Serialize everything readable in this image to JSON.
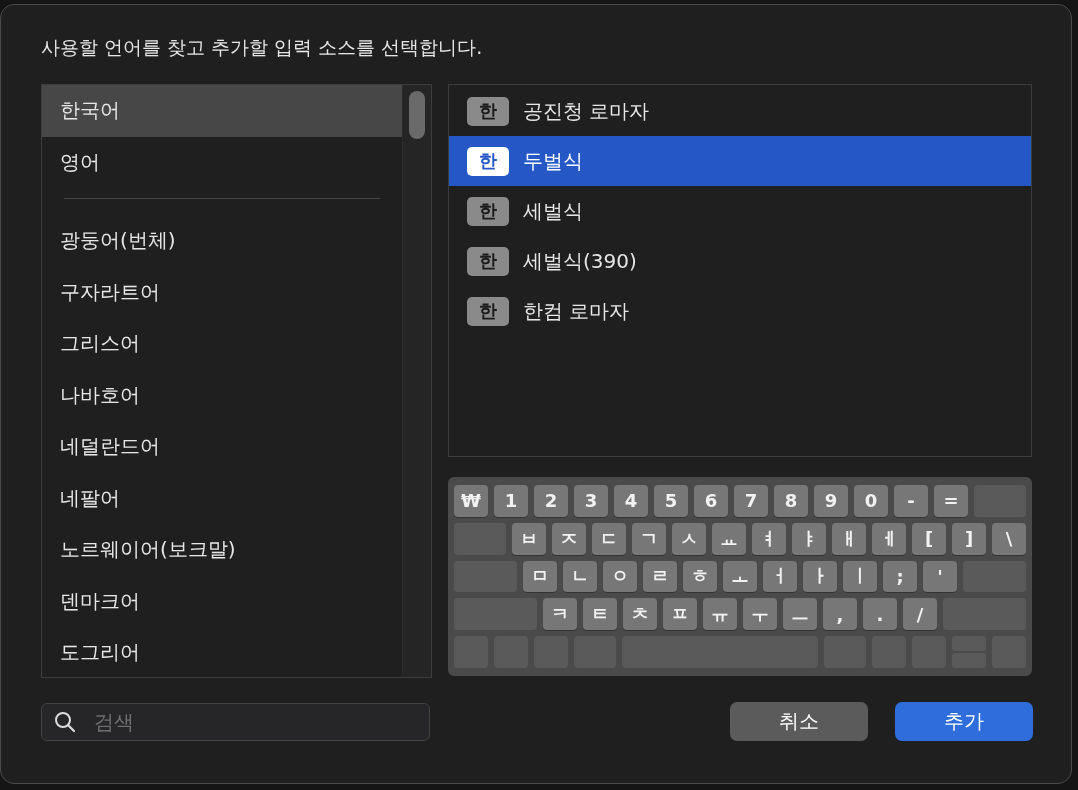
{
  "dialog": {
    "prompt": "사용할 언어를 찾고 추가할 입력 소스를 선택합니다."
  },
  "language_list": {
    "suggested": [
      {
        "label": "한국어",
        "selected": true
      },
      {
        "label": "영어",
        "selected": false
      }
    ],
    "others": [
      {
        "label": "광둥어(번체)",
        "selected": false
      },
      {
        "label": "구자라트어",
        "selected": false
      },
      {
        "label": "그리스어",
        "selected": false
      },
      {
        "label": "나바호어",
        "selected": false
      },
      {
        "label": "네덜란드어",
        "selected": false
      },
      {
        "label": "네팔어",
        "selected": false
      },
      {
        "label": "노르웨이어(보크말)",
        "selected": false
      },
      {
        "label": "덴마크어",
        "selected": false
      },
      {
        "label": "도그리어",
        "selected": false
      }
    ]
  },
  "input_sources": [
    {
      "badge": "한",
      "label": "공진청 로마자",
      "selected": false
    },
    {
      "badge": "한",
      "label": "두벌식",
      "selected": true
    },
    {
      "badge": "한",
      "label": "세벌식",
      "selected": false
    },
    {
      "badge": "한",
      "label": "세벌식(390)",
      "selected": false
    },
    {
      "badge": "한",
      "label": "한컴 로마자",
      "selected": false
    }
  ],
  "keyboard": {
    "rows": [
      [
        {
          "kind": "key",
          "label": "₩"
        },
        {
          "kind": "key",
          "label": "1"
        },
        {
          "kind": "key",
          "label": "2"
        },
        {
          "kind": "key",
          "label": "3"
        },
        {
          "kind": "key",
          "label": "4"
        },
        {
          "kind": "key",
          "label": "5"
        },
        {
          "kind": "key",
          "label": "6"
        },
        {
          "kind": "key",
          "label": "7"
        },
        {
          "kind": "key",
          "label": "8"
        },
        {
          "kind": "key",
          "label": "9"
        },
        {
          "kind": "key",
          "label": "0"
        },
        {
          "kind": "key",
          "label": "-"
        },
        {
          "kind": "key",
          "label": "="
        },
        {
          "kind": "fill"
        }
      ],
      [
        {
          "kind": "fill"
        },
        {
          "kind": "key",
          "label": "ㅂ"
        },
        {
          "kind": "key",
          "label": "ㅈ"
        },
        {
          "kind": "key",
          "label": "ㄷ"
        },
        {
          "kind": "key",
          "label": "ㄱ"
        },
        {
          "kind": "key",
          "label": "ㅅ"
        },
        {
          "kind": "key",
          "label": "ㅛ"
        },
        {
          "kind": "key",
          "label": "ㅕ"
        },
        {
          "kind": "key",
          "label": "ㅑ"
        },
        {
          "kind": "key",
          "label": "ㅐ"
        },
        {
          "kind": "key",
          "label": "ㅔ"
        },
        {
          "kind": "key",
          "label": "["
        },
        {
          "kind": "key",
          "label": "]"
        },
        {
          "kind": "key",
          "label": "\\"
        }
      ],
      [
        {
          "kind": "fill"
        },
        {
          "kind": "key",
          "label": "ㅁ"
        },
        {
          "kind": "key",
          "label": "ㄴ"
        },
        {
          "kind": "key",
          "label": "ㅇ"
        },
        {
          "kind": "key",
          "label": "ㄹ"
        },
        {
          "kind": "key",
          "label": "ㅎ"
        },
        {
          "kind": "key",
          "label": "ㅗ"
        },
        {
          "kind": "key",
          "label": "ㅓ"
        },
        {
          "kind": "key",
          "label": "ㅏ"
        },
        {
          "kind": "key",
          "label": "ㅣ"
        },
        {
          "kind": "key",
          "label": ";"
        },
        {
          "kind": "key",
          "label": "'"
        },
        {
          "kind": "fill"
        }
      ],
      [
        {
          "kind": "fill"
        },
        {
          "kind": "key",
          "label": "ㅋ"
        },
        {
          "kind": "key",
          "label": "ㅌ"
        },
        {
          "kind": "key",
          "label": "ㅊ"
        },
        {
          "kind": "key",
          "label": "ㅍ"
        },
        {
          "kind": "key",
          "label": "ㅠ"
        },
        {
          "kind": "key",
          "label": "ㅜ"
        },
        {
          "kind": "key",
          "label": "ㅡ"
        },
        {
          "kind": "key",
          "label": ","
        },
        {
          "kind": "key",
          "label": "."
        },
        {
          "kind": "key",
          "label": "/"
        },
        {
          "kind": "fill"
        }
      ],
      [
        {
          "kind": "mod"
        },
        {
          "kind": "mod"
        },
        {
          "kind": "mod"
        },
        {
          "kind": "wide"
        },
        {
          "kind": "fill"
        },
        {
          "kind": "wide"
        },
        {
          "kind": "mod"
        },
        {
          "kind": "mod"
        },
        {
          "kind": "split"
        },
        {
          "kind": "mod"
        }
      ]
    ]
  },
  "search": {
    "placeholder": "검색"
  },
  "buttons": [
    {
      "kind": "secondary",
      "label": "취소"
    },
    {
      "kind": "primary",
      "label": "추가"
    }
  ]
}
